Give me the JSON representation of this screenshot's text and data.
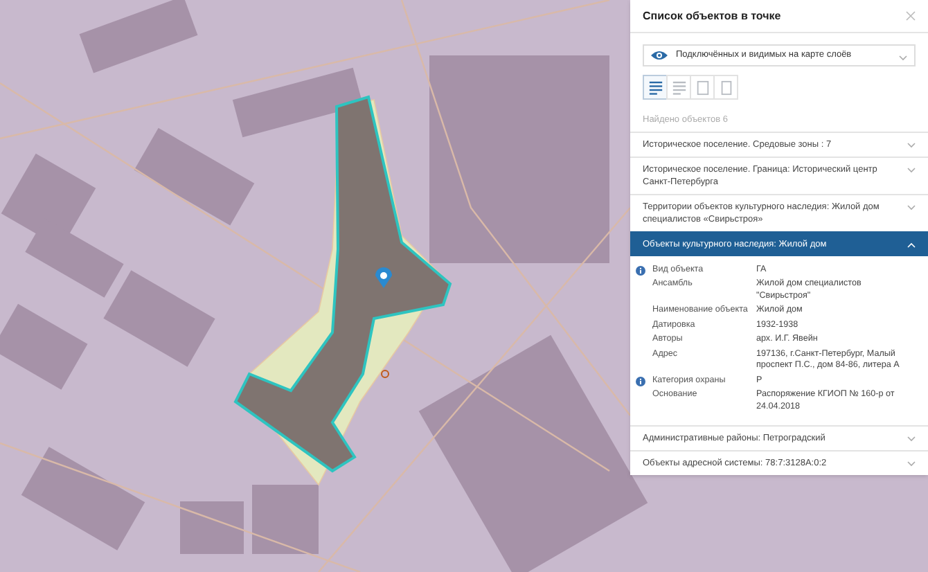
{
  "panel": {
    "title": "Список объектов в точке",
    "layer_select": {
      "value": "Подключённых и видимых на карте слоёв"
    },
    "view_buttons": [
      {
        "selected": true
      },
      {
        "selected": false
      },
      {
        "selected": false
      },
      {
        "selected": false
      }
    ],
    "found_label": "Найдено объектов 6",
    "groups": [
      {
        "title": "Историческое поселение. Средовые зоны : 7",
        "expanded": false
      },
      {
        "title": "Историческое поселение. Граница: Исторический центр Санкт-Петербурга",
        "expanded": false
      },
      {
        "title": "Территории объектов культурного наследия: Жилой дом специалистов «Свирьстроя»",
        "expanded": false
      },
      {
        "title": "Объекты культурного наследия: Жилой дом",
        "expanded": true,
        "fields": [
          {
            "label": "Вид объекта",
            "value": "ГА",
            "info": true
          },
          {
            "label": "Ансамбль",
            "value": "Жилой дом специалистов \"Свирьстроя\"",
            "info": false
          },
          {
            "label": "Наименование объекта",
            "value": "Жилой дом",
            "info": false
          },
          {
            "label": "Датировка",
            "value": "1932-1938",
            "info": false
          },
          {
            "label": "Авторы",
            "value": "арх. И.Г. Явейн",
            "info": false
          },
          {
            "label": "Адрес",
            "value": "197136, г.Санкт-Петербург, Малый проспект П.С., дом 84-86, литера А",
            "info": false
          },
          {
            "label": "Категория охраны",
            "value": "Р",
            "info": true
          },
          {
            "label": "Основание",
            "value": "Распоряжение КГИОП № 160-р от 24.04.2018",
            "info": false
          }
        ]
      },
      {
        "title": "Административные районы: Петроградский",
        "expanded": false
      },
      {
        "title": "Объекты адресной системы: 78:7:3128A:0:2",
        "expanded": false
      }
    ]
  }
}
